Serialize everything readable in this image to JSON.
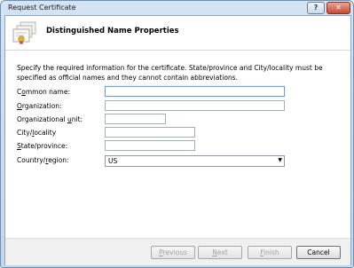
{
  "window": {
    "title": "Request Certificate",
    "help_label": "?",
    "close_label": "✕"
  },
  "header": {
    "title": "Distinguished Name Properties",
    "icon": "certificate-icon"
  },
  "instructions": "Specify the required information for the certificate. State/province and City/locality must be specified as official names and they cannot contain abbreviations.",
  "fields": {
    "common_name": {
      "label_pre": "C",
      "label_u": "o",
      "label_post": "mmon name:",
      "value": ""
    },
    "organization": {
      "label_pre": "",
      "label_u": "O",
      "label_post": "rganization:",
      "value": ""
    },
    "org_unit": {
      "label_pre": "Organizational ",
      "label_u": "u",
      "label_post": "nit:",
      "value": ""
    },
    "city": {
      "label_pre": "City/",
      "label_u": "l",
      "label_post": "ocality",
      "value": ""
    },
    "state": {
      "label_pre": "",
      "label_u": "S",
      "label_post": "tate/province:",
      "value": ""
    },
    "country": {
      "label_pre": "Country/",
      "label_u": "r",
      "label_post": "egion:",
      "value": "US"
    }
  },
  "buttons": {
    "previous": {
      "pre": "",
      "u": "P",
      "post": "revious"
    },
    "next": {
      "pre": "",
      "u": "N",
      "post": "ext"
    },
    "finish": {
      "pre": "",
      "u": "F",
      "post": "inish"
    },
    "cancel": {
      "label": "Cancel"
    }
  }
}
